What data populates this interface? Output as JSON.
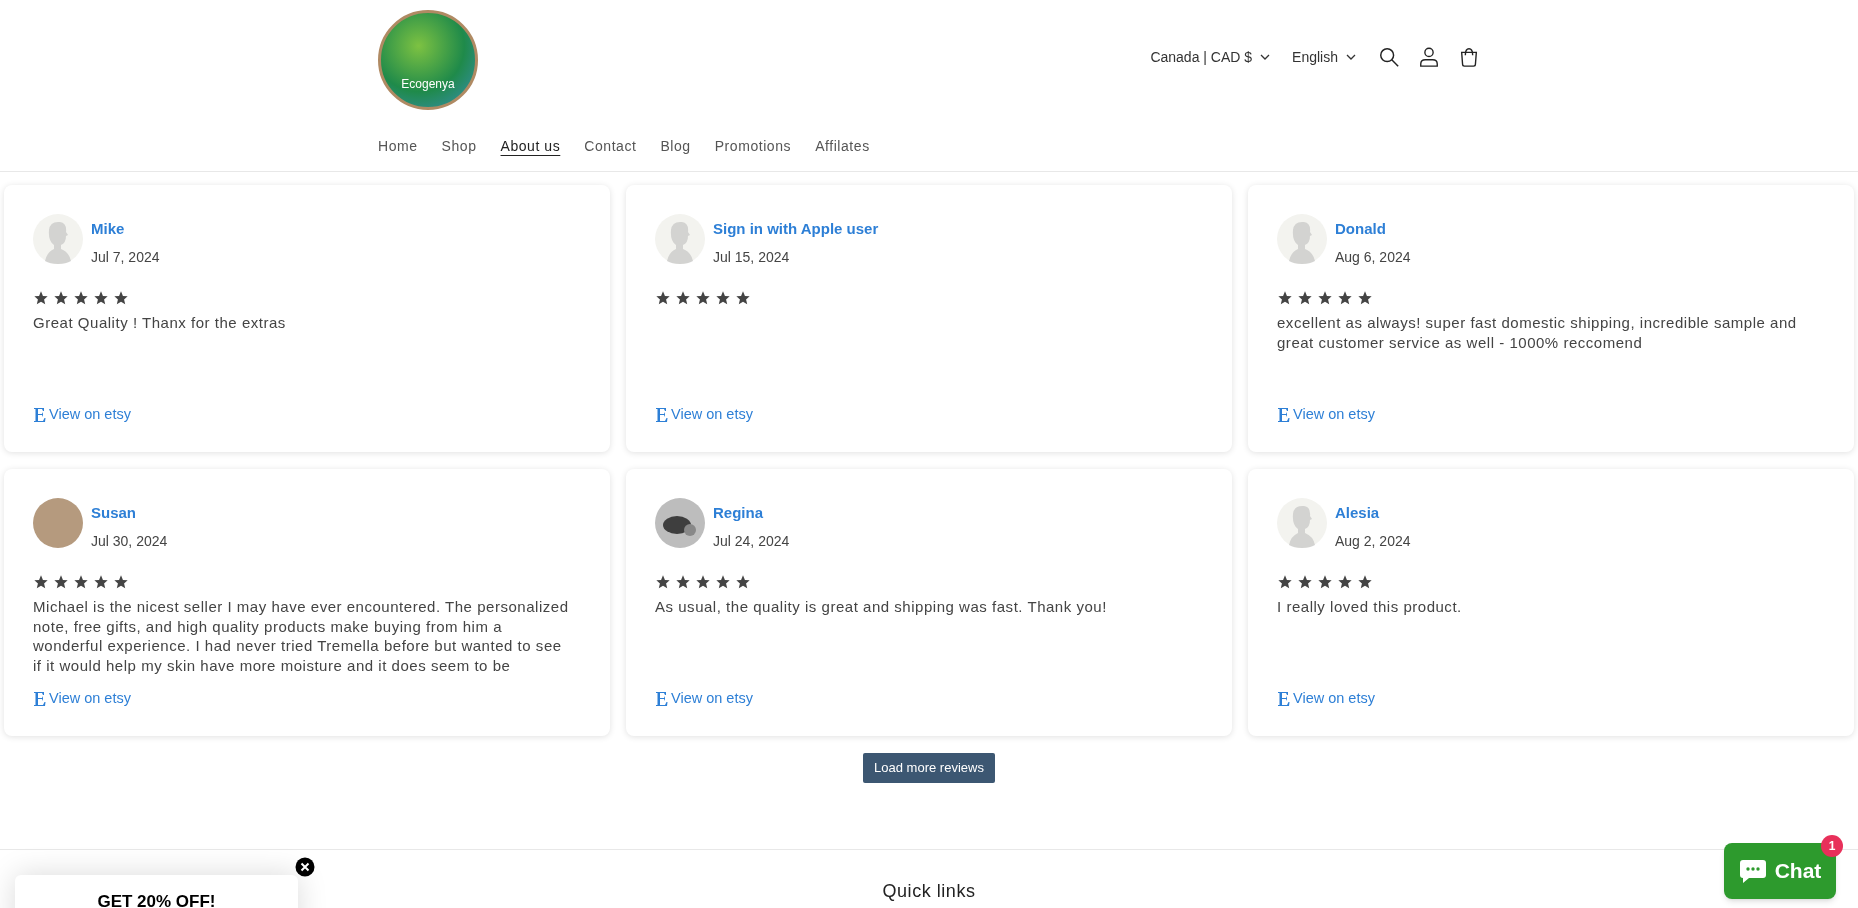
{
  "header": {
    "logo_text": "Ecogenya",
    "locale": [
      {
        "label": "Canada | CAD $"
      },
      {
        "label": "English"
      }
    ],
    "nav": [
      {
        "label": "Home",
        "selected": false
      },
      {
        "label": "Shop",
        "selected": false
      },
      {
        "label": "About us",
        "selected": true
      },
      {
        "label": "Contact",
        "selected": false
      },
      {
        "label": "Blog",
        "selected": false
      },
      {
        "label": "Promotions",
        "selected": false
      },
      {
        "label": "Affilates",
        "selected": false
      }
    ]
  },
  "reviews": [
    {
      "name": "Mike",
      "date": "Jul 7, 2024",
      "kind": "silhouette",
      "stars": 5,
      "text": "Great Quality ! Thanx for the extras",
      "link": "View on etsy"
    },
    {
      "name": "Sign in with Apple user",
      "date": "Jul 15, 2024",
      "kind": "silhouette",
      "stars": 5,
      "link": "View on etsy"
    },
    {
      "name": "Donald",
      "date": "Aug 6, 2024",
      "kind": "silhouette",
      "stars": 5,
      "text": "excellent as always! super fast domestic shipping, incredible sample and great customer service as well - 1000% reccomend",
      "link": "View on etsy"
    },
    {
      "name": "Susan",
      "date": "Jul 30, 2024",
      "kind": "photo",
      "stars": 5,
      "text": "Michael is the nicest seller I may have ever encountered. The personalized note, free gifts, and high quality products make buying from him a wonderful experience. I had never tried Tremella before but wanted to see if it would help my skin have more moisture and it does seem to be",
      "link": "View on etsy"
    },
    {
      "name": "Regina",
      "date": "Jul 24, 2024",
      "kind": "blob",
      "stars": 5,
      "text": "As usual, the quality is great and shipping was fast. Thank you!",
      "link": "View on etsy"
    },
    {
      "name": "Alesia",
      "date": "Aug 2, 2024",
      "kind": "silhouette",
      "stars": 5,
      "text": "I really loved this product.",
      "link": "View on etsy"
    }
  ],
  "load_more": "Load more reviews",
  "footer": {
    "heading": "Quick links"
  },
  "popup": {
    "title": "GET 20% OFF!"
  },
  "chat": {
    "label": "Chat",
    "badge": "1"
  }
}
